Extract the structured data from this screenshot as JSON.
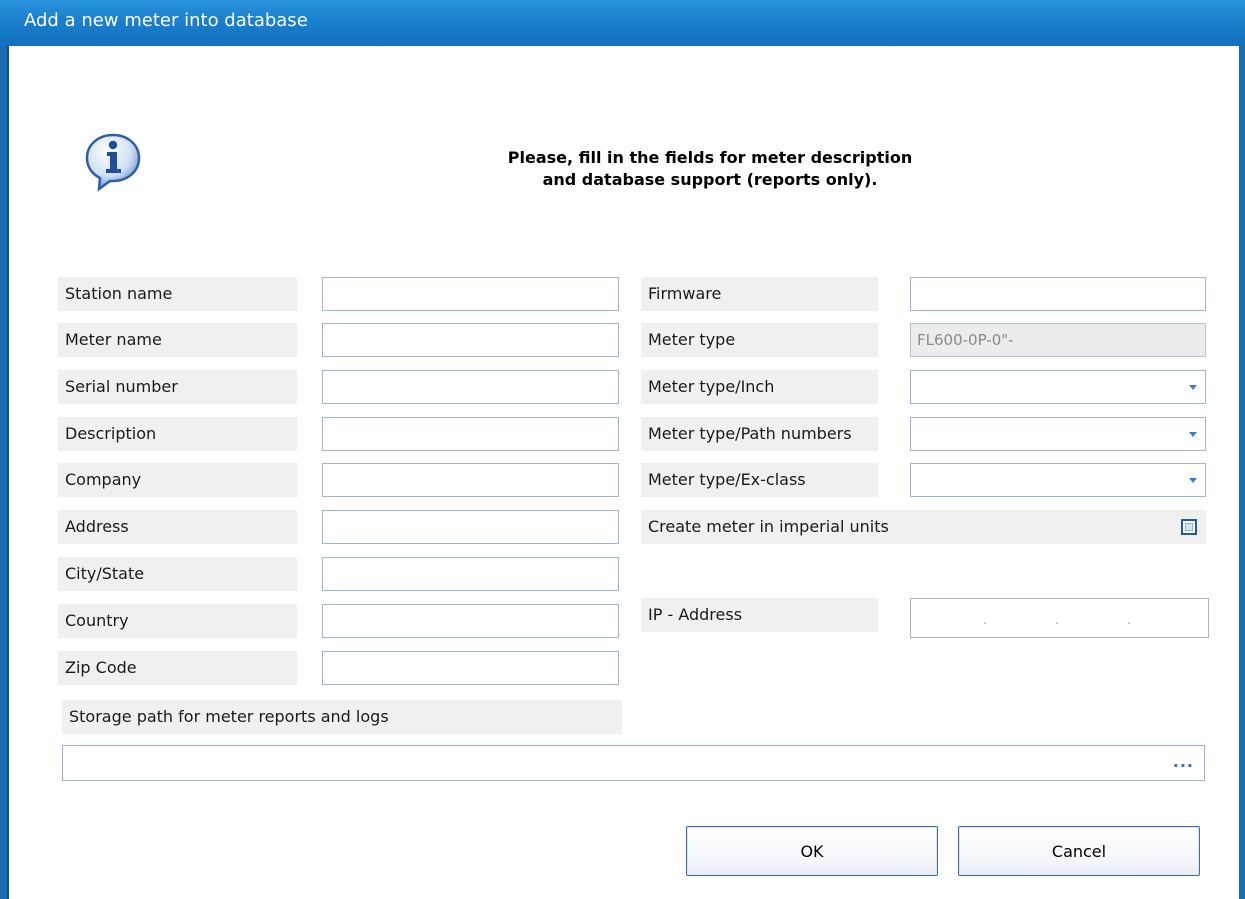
{
  "window": {
    "title": "Add a new meter into database"
  },
  "message": {
    "line1": "Please, fill in the fields for meter description",
    "line2": "and database support (reports only)."
  },
  "left_fields": [
    {
      "label": "Station name",
      "value": ""
    },
    {
      "label": "Meter name",
      "value": ""
    },
    {
      "label": "Serial number",
      "value": ""
    },
    {
      "label": "Description",
      "value": ""
    },
    {
      "label": "Company",
      "value": ""
    },
    {
      "label": "Address",
      "value": ""
    },
    {
      "label": "City/State",
      "value": ""
    },
    {
      "label": "Country",
      "value": ""
    },
    {
      "label": "Zip Code",
      "value": ""
    }
  ],
  "right_fields": {
    "firmware": {
      "label": "Firmware",
      "value": ""
    },
    "meter_type": {
      "label": "Meter type",
      "value": "FL600-0P-0\"-"
    },
    "meter_type_inch": {
      "label": "Meter type/Inch",
      "value": ""
    },
    "meter_type_path": {
      "label": "Meter type/Path numbers",
      "value": ""
    },
    "meter_type_ex": {
      "label": "Meter type/Ex-class",
      "value": ""
    },
    "imperial": {
      "label": "Create meter in imperial units",
      "checked": false
    },
    "ip": {
      "label": "IP - Address",
      "value": ""
    }
  },
  "storage": {
    "label": "Storage path for meter reports and logs",
    "value": "",
    "browse": "..."
  },
  "buttons": {
    "ok": "OK",
    "cancel": "Cancel"
  },
  "icons": {
    "info": "info-icon",
    "dropdown": "chevron-down-icon"
  },
  "colors": {
    "titlebar": "#1a7fcd",
    "label_bg": "#f0f0f0",
    "field_border": "#9fb5d2"
  }
}
